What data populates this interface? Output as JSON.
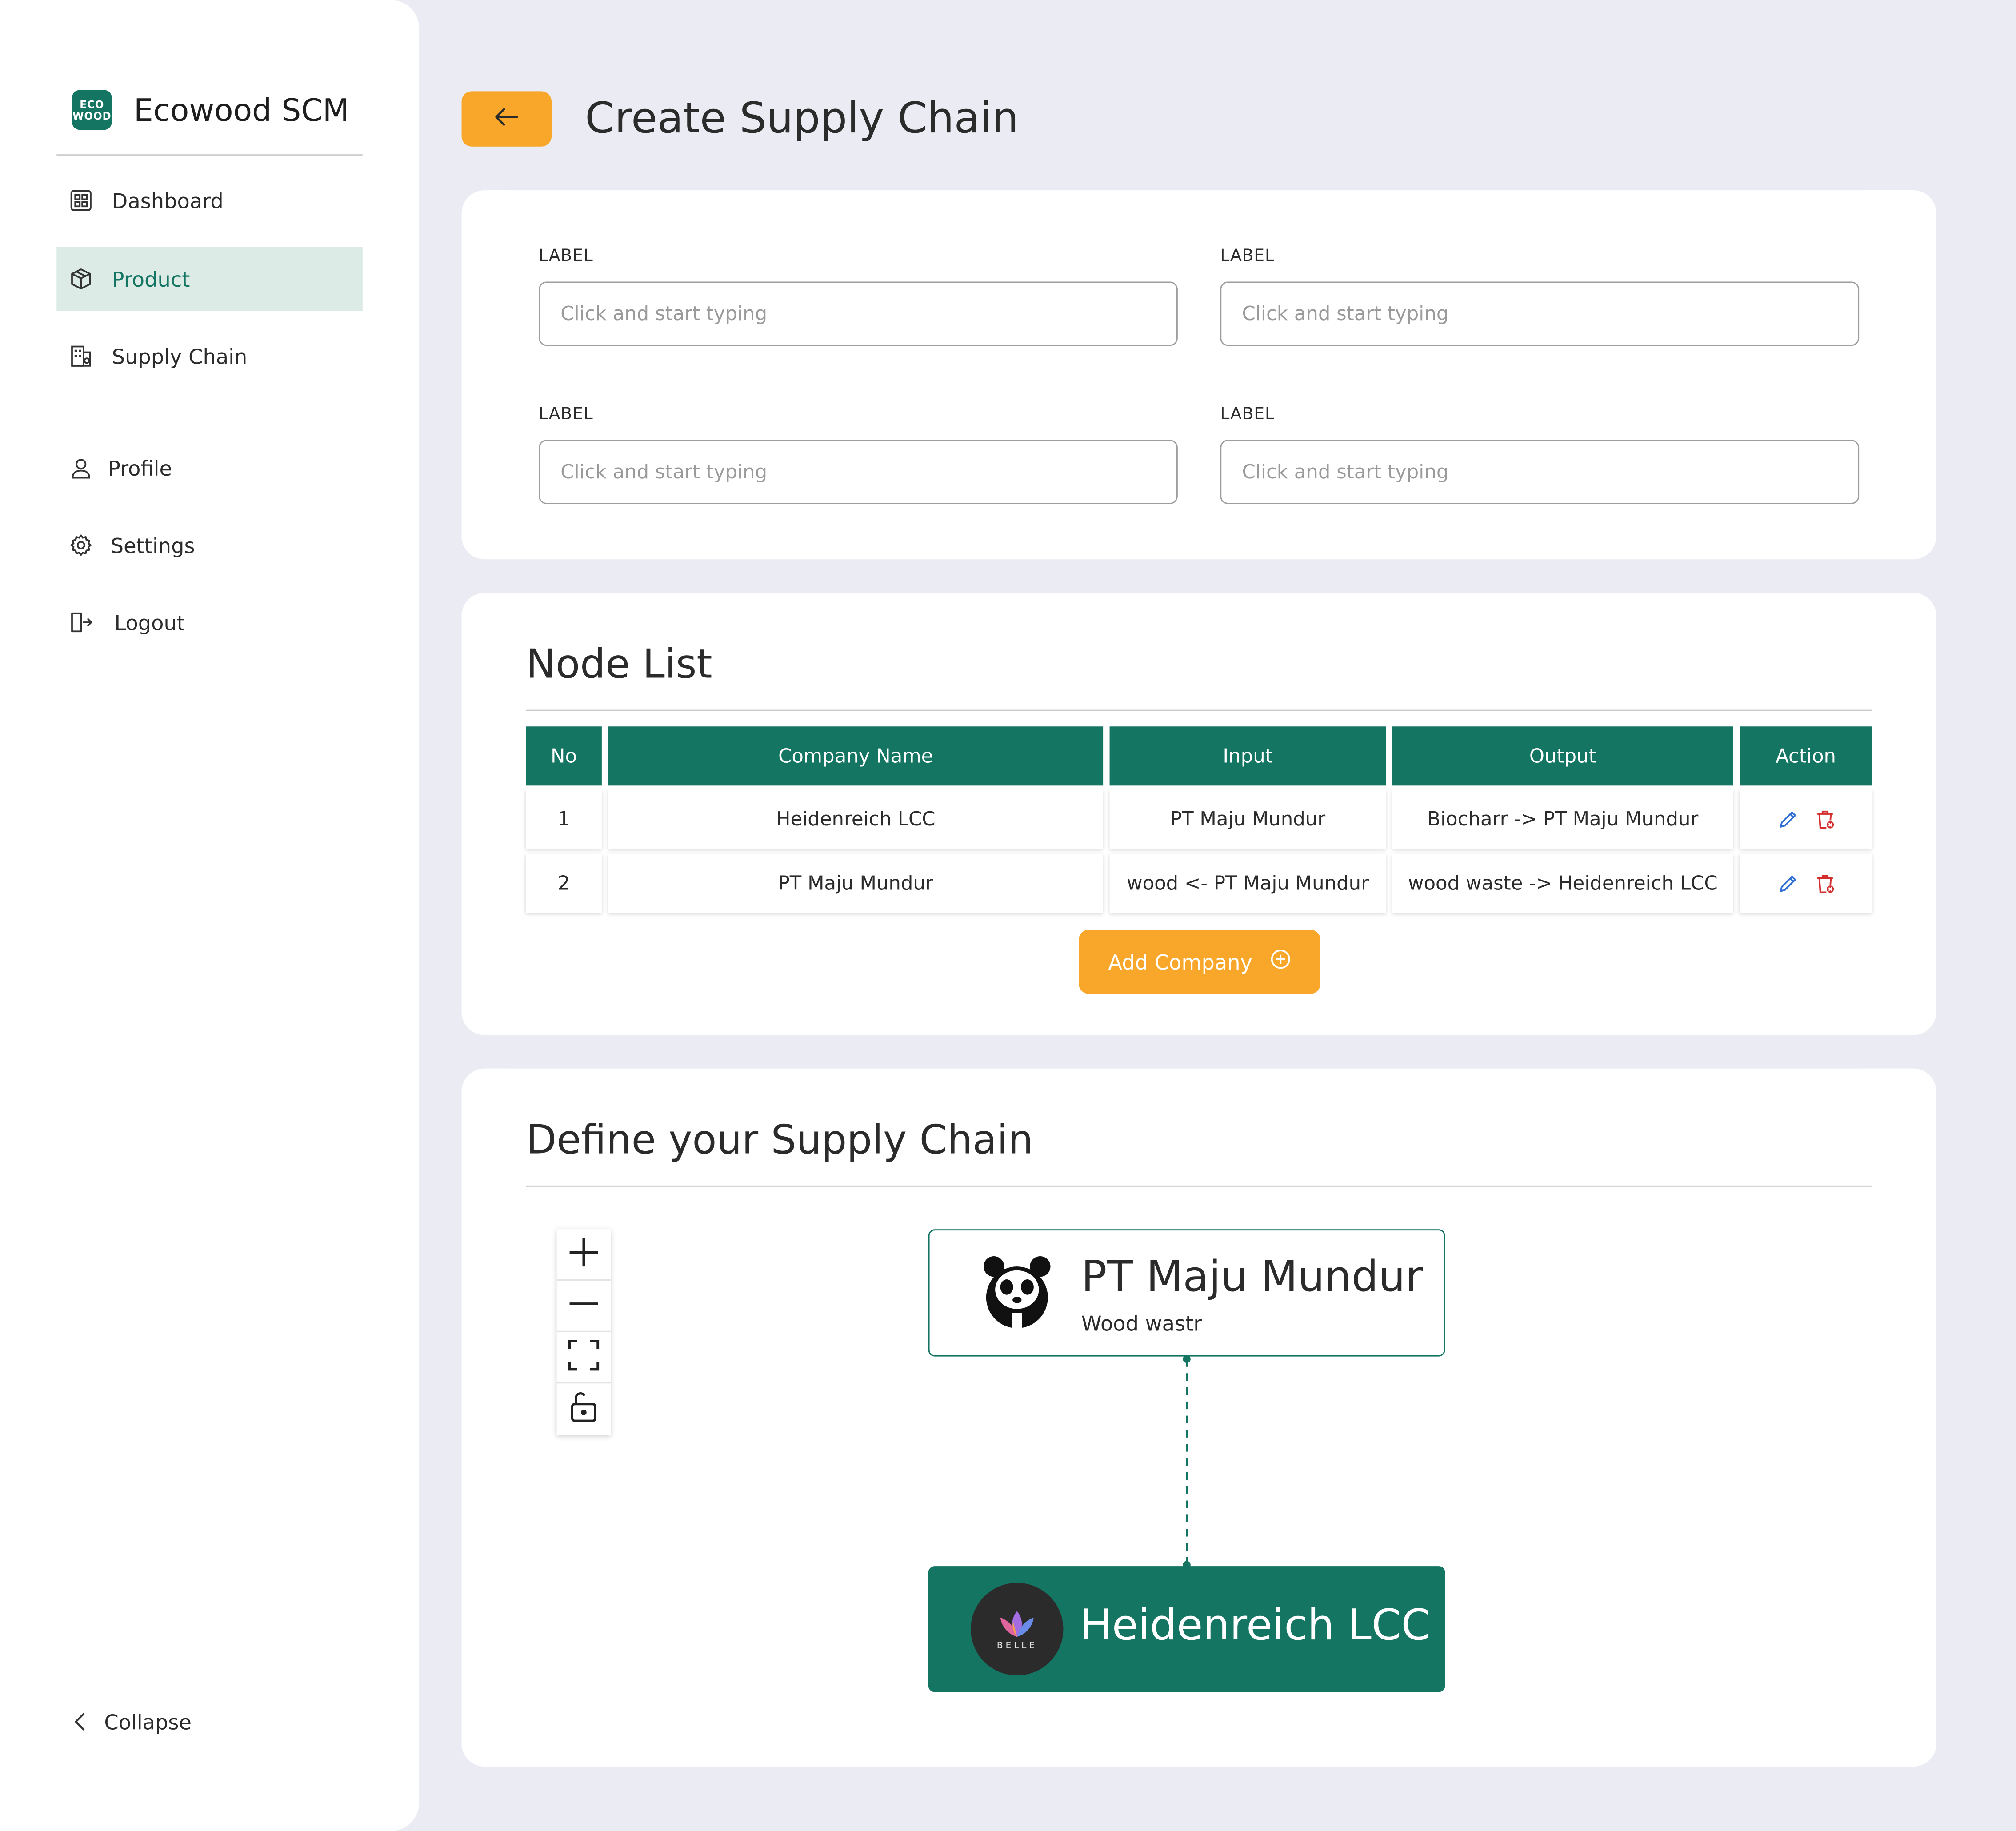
{
  "app": {
    "name": "Ecowood SCM",
    "logo_text_top": "ECO",
    "logo_text_bottom": "WOOD"
  },
  "sidebar": {
    "items": [
      {
        "label": "Dashboard",
        "icon": "dashboard-icon"
      },
      {
        "label": "Product",
        "icon": "box-icon",
        "active": true
      },
      {
        "label": "Supply Chain",
        "icon": "building-icon"
      },
      {
        "label": "Profile",
        "icon": "user-icon"
      },
      {
        "label": "Settings",
        "icon": "gear-icon"
      },
      {
        "label": "Logout",
        "icon": "logout-icon"
      }
    ],
    "collapse_label": "Collapse"
  },
  "header": {
    "title": "Create Supply Chain"
  },
  "form": {
    "fields": [
      {
        "label": "LABEL",
        "placeholder": "Click and start typing",
        "value": ""
      },
      {
        "label": "LABEL",
        "placeholder": "Click and start typing",
        "value": ""
      },
      {
        "label": "LABEL",
        "placeholder": "Click and start typing",
        "value": ""
      },
      {
        "label": "LABEL",
        "placeholder": "Click and start typing",
        "value": ""
      }
    ]
  },
  "node_list": {
    "title": "Node List",
    "columns": [
      "No",
      "Company Name",
      "Input",
      "Output",
      "Action"
    ],
    "rows": [
      {
        "no": "1",
        "company": "Heidenreich LCC",
        "input": "PT Maju Mundur",
        "output": "Biocharr -> PT Maju Mundur"
      },
      {
        "no": "2",
        "company": "PT Maju Mundur",
        "input": "wood <- PT Maju Mundur",
        "output": "wood waste -> Heidenreich LCC"
      }
    ],
    "add_button": "Add Company"
  },
  "chain": {
    "title": "Define your Supply Chain",
    "nodes": [
      {
        "title": "PT Maju Mundur",
        "subtitle": "Wood wastr",
        "logo": "panda-logo"
      },
      {
        "title": "Heidenreich LCC",
        "logo": "belle-logo",
        "logo_text": "BELLE"
      }
    ],
    "controls": [
      "zoom-in-icon",
      "zoom-out-icon",
      "fit-view-icon",
      "unlock-icon"
    ]
  },
  "colors": {
    "primary": "#147563",
    "accent": "#f8a72a",
    "active_bg": "#dcebe6",
    "page_bg": "#ebecf3",
    "delete": "#d32f2f",
    "edit": "#2f6fd3"
  }
}
